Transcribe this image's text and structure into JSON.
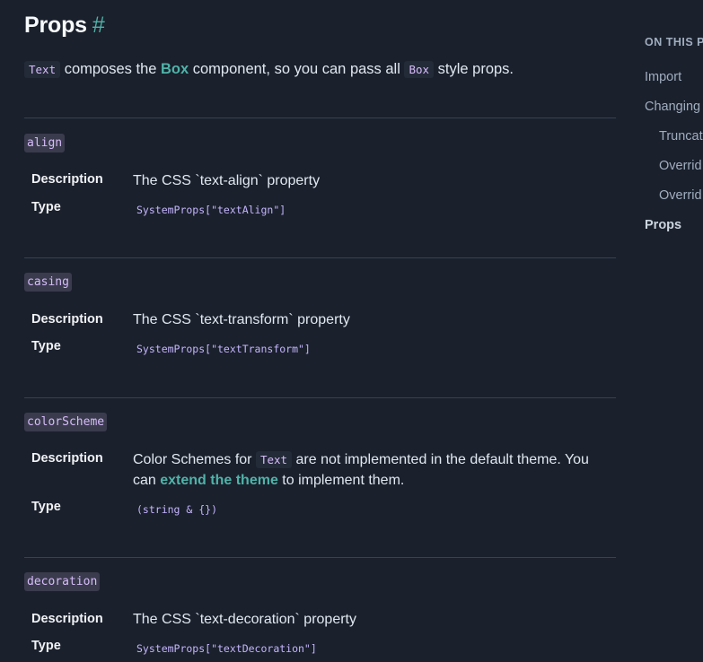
{
  "title": "Props",
  "title_anchor": "#",
  "intro": {
    "code1": "Text",
    "text1": " composes the ",
    "link": "Box",
    "text2": " component, so you can pass all ",
    "code2": "Box",
    "text3": " style props."
  },
  "labels": {
    "description": "Description",
    "type": "Type"
  },
  "props": [
    {
      "name": "align",
      "description": "The CSS `text-align` property",
      "type": "SystemProps[\"textAlign\"]"
    },
    {
      "name": "casing",
      "description": "The CSS `text-transform` property",
      "type": "SystemProps[\"textTransform\"]"
    },
    {
      "name": "colorScheme",
      "description_parts": {
        "before": "Color Schemes for ",
        "code": "Text",
        "middle": " are not implemented in the default theme. You can ",
        "link": "extend the theme",
        "after": " to implement them."
      },
      "type": "(string & {})"
    },
    {
      "name": "decoration",
      "description": "The CSS `text-decoration` property",
      "type": "SystemProps[\"textDecoration\"]"
    }
  ],
  "toc": {
    "heading": "ON THIS PA",
    "items": [
      "Import",
      "Changing",
      "Truncat",
      "Overrid",
      "Overrid",
      "Props"
    ]
  },
  "colors": {
    "background": "#1a202c",
    "accent": "#4fb3a9",
    "code": "#d6bcfa"
  }
}
